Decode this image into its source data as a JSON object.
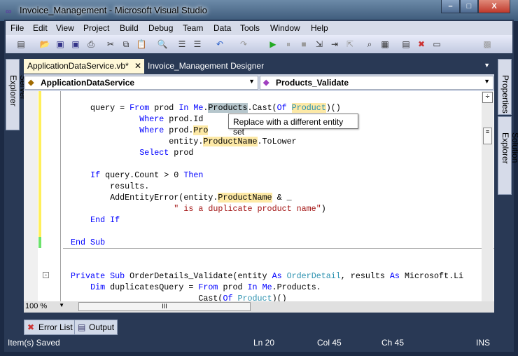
{
  "window": {
    "title": "Invoice_Management - Microsoft Visual Studio",
    "controls": [
      "minimize",
      "maximize",
      "close"
    ]
  },
  "menu": [
    "File",
    "Edit",
    "View",
    "Project",
    "Build",
    "Debug",
    "Team",
    "Data",
    "Tools",
    "Window",
    "Help"
  ],
  "tabs": [
    {
      "label": "ApplicationDataService.vb*",
      "active": true
    },
    {
      "label": "Invoice_Management Designer",
      "active": false
    }
  ],
  "combos": {
    "class": "ApplicationDataService",
    "member": "Products_Validate"
  },
  "tooltip": "Replace with a different entity set",
  "zoom": "100 %",
  "bottom_tabs": [
    "Error List",
    "Output"
  ],
  "side_left": [
    "Server Explorer"
  ],
  "side_right": [
    "Properties",
    "Solution Explorer"
  ],
  "status": {
    "message": "Item(s) Saved",
    "ln": "Ln 20",
    "col": "Col 45",
    "ch": "Ch 45",
    "mode": "INS"
  },
  "colors": {
    "frame": "#293955",
    "keyword": "#0000ff",
    "type": "#2b91af",
    "string": "#a31515",
    "highlight": "#fde9a6"
  }
}
